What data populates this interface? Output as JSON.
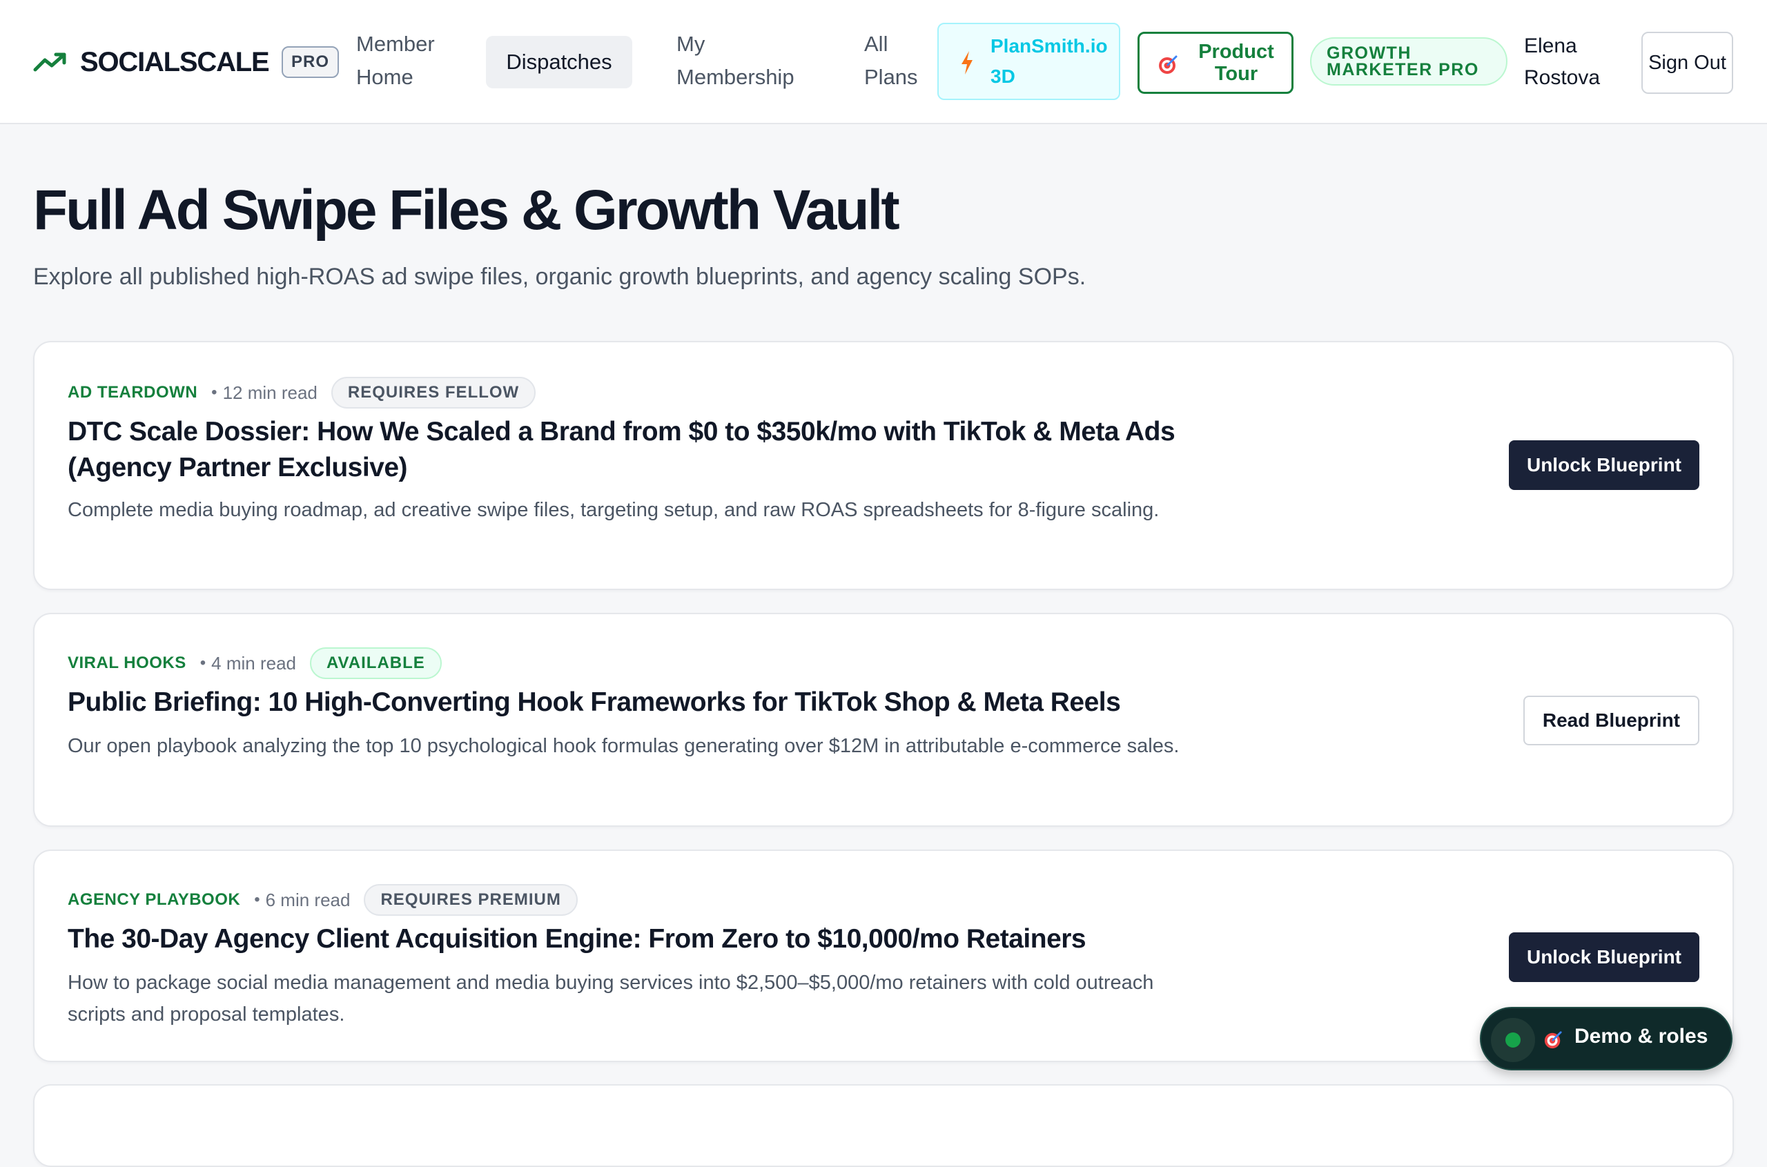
{
  "header": {
    "brand": "SOCIALSCALE",
    "brand_badge": "PRO",
    "nav": [
      {
        "label": "Member Home"
      },
      {
        "label": "Dispatches",
        "active": true
      },
      {
        "label": "My Membership"
      },
      {
        "label": "All Plans"
      }
    ],
    "plansmith_label": "PlanSmith.io 3D",
    "tour_label": "Product Tour",
    "tier_badge": "GROWTH MARKETER PRO",
    "user_name": "Elena Rostova",
    "signout_label": "Sign Out",
    "icons": {
      "brand": "trending-up-icon",
      "plansmith": "bolt-icon",
      "tour": "target-icon"
    }
  },
  "page": {
    "title": "Full Ad Swipe Files & Growth Vault",
    "subtitle": "Explore all published high-ROAS ad swipe files, organic growth blueprints, and agency scaling SOPs."
  },
  "cards": [
    {
      "category": "AD TEARDOWN",
      "read_time": "12 min read",
      "access": "REQUIRES FELLOW",
      "locked": true,
      "title": "DTC Scale Dossier: How We Scaled a Brand from $0 to $350k/mo with TikTok & Meta Ads (Agency Partner Exclusive)",
      "description": "Complete media buying roadmap, ad creative swipe files, targeting setup, and raw ROAS spreadsheets for 8-figure scaling.",
      "action": "Unlock Blueprint"
    },
    {
      "category": "VIRAL HOOKS",
      "read_time": "4 min read",
      "access": "AVAILABLE",
      "locked": false,
      "title": "Public Briefing: 10 High-Converting Hook Frameworks for TikTok Shop & Meta Reels",
      "description": "Our open playbook analyzing the top 10 psychological hook formulas generating over $12M in attributable e-commerce sales.",
      "action": "Read Blueprint"
    },
    {
      "category": "AGENCY PLAYBOOK",
      "read_time": "6 min read",
      "access": "REQUIRES PREMIUM",
      "locked": true,
      "title": "The 30-Day Agency Client Acquisition Engine: From Zero to $10,000/mo Retainers",
      "description": "How to package social media management and media buying services into $2,500–$5,000/mo retainers with cold outreach scripts and proposal templates.",
      "action": "Unlock Blueprint"
    }
  ],
  "demo": {
    "label": "Demo & roles",
    "status": "online",
    "icon": "target-icon"
  },
  "colors": {
    "accent_green": "#15803d",
    "button_dark": "#1a2238",
    "plansmith_cyan": "#06c8e4",
    "page_bg": "#f6f7f9"
  }
}
